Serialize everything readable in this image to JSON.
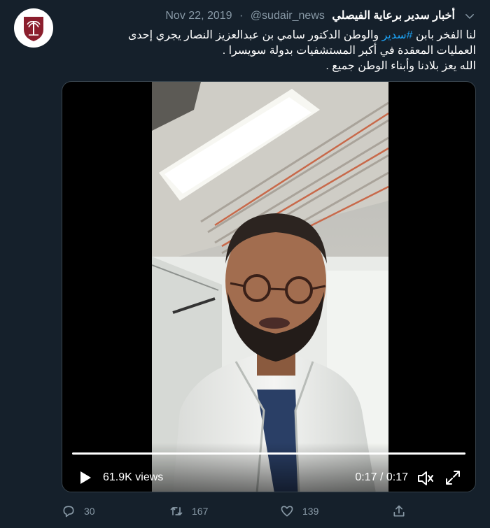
{
  "tweet": {
    "display_name": "أخبار سدير برعاية الفيصلي",
    "handle": "@sudair_news",
    "separator": "·",
    "date": "Nov 22, 2019",
    "text_line1_before": "لنا الفخر بابن ",
    "hashtag": "#سدير",
    "text_line1_after": " والوطن الدكتور سامي بن عبدالعزيز النصار  يجري إحدى",
    "text_line2": "العمليات المعقدة في أكبر المستشفيات بدولة سويسرا .",
    "text_line3": "الله يعز بلادنا وأبناء الوطن جميع ."
  },
  "video": {
    "views": "61.9K views",
    "time": "0:17 / 0:17",
    "progress": 1.0
  },
  "actions": {
    "reply_count": "30",
    "retweet_count": "167",
    "like_count": "139"
  },
  "colors": {
    "background": "#15202b",
    "text": "#ffffff",
    "muted": "#8899a6",
    "link": "#1da1f2",
    "avatar_logo": "#8b1e2d"
  },
  "icons": [
    "caret-down-icon",
    "play-icon",
    "volume-icon",
    "fullscreen-icon",
    "reply-icon",
    "retweet-icon",
    "like-icon",
    "share-icon"
  ]
}
